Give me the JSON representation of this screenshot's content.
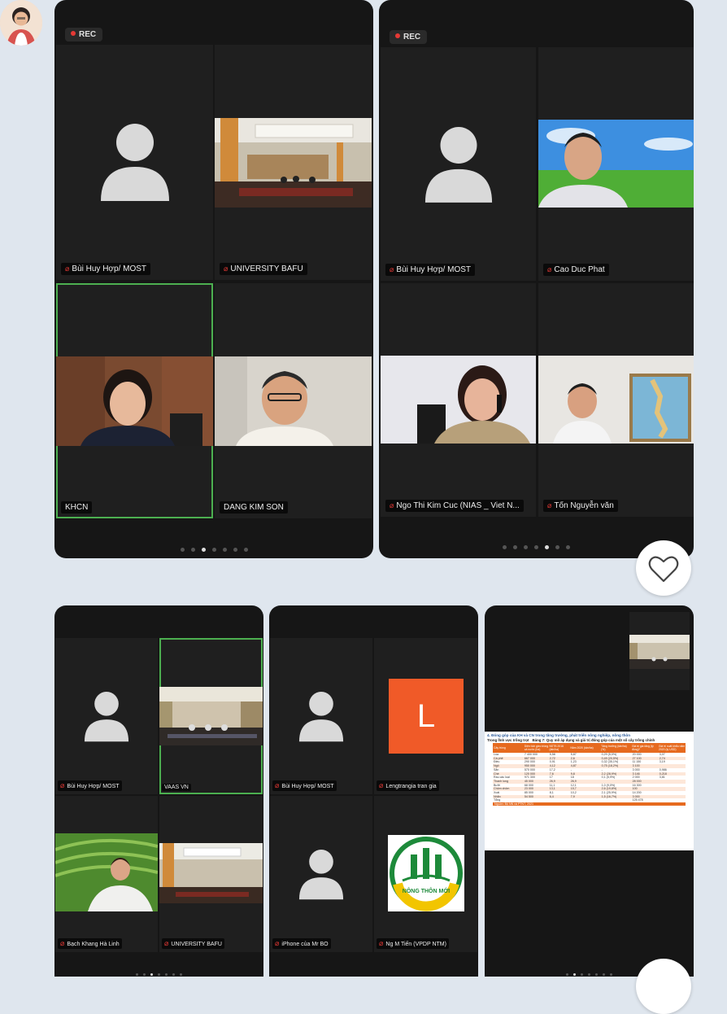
{
  "screenshots": {
    "one": {
      "rec": "REC",
      "tiles": [
        "Bùi Huy Hợp/ MOST",
        "UNIVERSITY BAFU",
        "KHCN",
        "DANG KIM SON"
      ]
    },
    "two": {
      "rec": "REC",
      "tiles": [
        "Bùi Huy Hợp/ MOST",
        "Cao Duc Phat",
        "Ngo Thi Kim Cuc (NIAS _ Viet N...",
        "Tốn Nguyễn văn"
      ]
    },
    "three": {
      "tiles": [
        "Bùi Huy Hợp/ MOST",
        "VAAS VN",
        "Bạch Khang Hà Linh",
        "UNIVERSITY BAFU"
      ]
    },
    "four": {
      "tiles": [
        "Bùi Huy Hợp/ MOST",
        "Lengtrangia tran gia",
        "iPhone của Mr BO",
        "Ng M Tiến (VPDP NTM)"
      ],
      "initial": "L",
      "logo_text": "NÔNG THÔN MỚI"
    },
    "five": {
      "slide_heading": "4. Đóng góp của KH và CN trong tăng trưởng, phát triển nông nghiệp, nông thôn",
      "slide_subtitle": "Trong lĩnh vực trồng trọt",
      "table_title": "Bảng 7: Quy mô áp dụng và giá trị đóng góp của một số cây trồng chính",
      "table_headers": [
        "Cây trồng",
        "Diện tích gieo trồng cả nước (ha)",
        "NSTB 2016 (tấn/ha)",
        "Năm 2020 (tấn/ha)",
        "Tăng trưởng (tấn/ha) (%)",
        "Giá trị gia tăng (tỷ đồng)*",
        "Giá trị xuất khẩu năm 2020 (tỷ USD)"
      ],
      "table_rows": [
        [
          "Lúa",
          "7 400 000",
          "5,58",
          "5,87",
          "0,29 (5,0%)",
          "20 000",
          "3,07"
        ],
        [
          "Cà phê",
          "667 000",
          "2,72",
          "2,6",
          "0,49 (20,5%)",
          "27 100",
          "2,74"
        ],
        [
          "Điều",
          "290 000",
          "0,91",
          "1,23",
          "0,32 (35,1%)",
          "11 150",
          "3,19"
        ],
        [
          "Ngô",
          "950 000",
          "4,12",
          "4,87",
          "0,75 (18,2%)",
          "3 100",
          ""
        ],
        [
          "Sắn",
          "570 000",
          "17,2",
          "-",
          "-",
          "3 000",
          "0,986"
        ],
        [
          "Chè",
          "120 000",
          "7,6",
          "9,8",
          "2,2 (28,9%)",
          "3 146",
          "0,218"
        ],
        [
          "Rau các loại",
          "971 300",
          "17",
          "18",
          "0,1 (5,9%)",
          "2 000",
          "3,81"
        ],
        [
          "Thanh long",
          "45 000",
          "26,9",
          "26,9",
          "",
          "28 000",
          ""
        ],
        [
          "Bưởi",
          "68 000",
          "11,1",
          "12,1",
          "1,0 (9,0%)",
          "16 300",
          ""
        ],
        [
          "Chôm chôm",
          "23 000",
          "13,1",
          "15,7",
          "2,6 (19,8%)",
          "100",
          ""
        ],
        [
          "Xoài",
          "85 000",
          "8,1",
          "10,2",
          "2,1 (25,9%)",
          "14 200",
          ""
        ],
        [
          "Nhãn",
          "54 500",
          "6,4",
          "7,9",
          "1,5 (16,7%)",
          "3 000",
          ""
        ],
        [
          "Tổng",
          "",
          "",
          "",
          "",
          "125 478",
          ""
        ]
      ],
      "table_source": "Nguồn: Bộ NN và PTNT, 2021"
    }
  },
  "colors": {
    "background": "#dfe6ee",
    "panel": "#161616",
    "tile": "#1f1f1f",
    "active_border": "#4caf50",
    "muted_mic": "#e53935",
    "initial_tile": "#f05a28",
    "slide_accent": "#e66a1f"
  },
  "icons": {
    "avatar": "default-user-silhouette-icon",
    "mic": "muted-mic-icon",
    "reaction": "heart-outline-icon"
  }
}
